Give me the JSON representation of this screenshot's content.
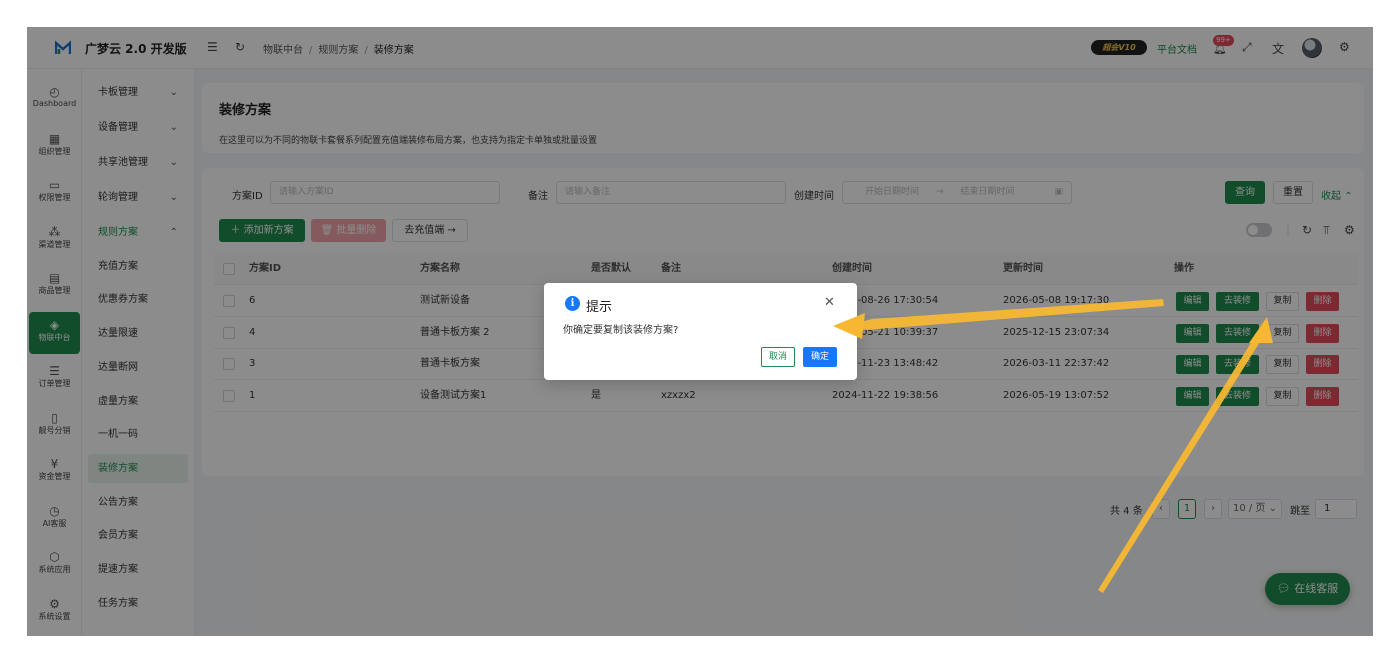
{
  "app": {
    "brand": "广梦云 2.0 开发版"
  },
  "breadcrumb": [
    "物联中台",
    "规则方案",
    "装修方案"
  ],
  "header_right": {
    "vip": "超会V10",
    "docs": "平台文档",
    "badge": "99+"
  },
  "rail": [
    {
      "label": "Dashboard",
      "icon": "dashboard-icon",
      "glyph": "◴"
    },
    {
      "label": "组织管理",
      "icon": "grid-icon",
      "glyph": "▦"
    },
    {
      "label": "权限管理",
      "icon": "monitor-icon",
      "glyph": "▭"
    },
    {
      "label": "渠道管理",
      "icon": "network-icon",
      "glyph": "⁂"
    },
    {
      "label": "商品管理",
      "icon": "store-icon",
      "glyph": "▤"
    },
    {
      "label": "物联中台",
      "icon": "iot-icon",
      "glyph": "◈"
    },
    {
      "label": "订单管理",
      "icon": "list-icon",
      "glyph": "☰"
    },
    {
      "label": "靓号分销",
      "icon": "phone-icon",
      "glyph": "▯"
    },
    {
      "label": "资金管理",
      "icon": "wallet-icon",
      "glyph": "¥"
    },
    {
      "label": "AI客服",
      "icon": "ai-icon",
      "glyph": "◷"
    },
    {
      "label": "系统应用",
      "icon": "cube-icon",
      "glyph": "⬡"
    },
    {
      "label": "系统设置",
      "icon": "gear-icon",
      "glyph": "⚙"
    }
  ],
  "submenu": [
    {
      "label": "卡板管理",
      "chev": "⌄"
    },
    {
      "label": "设备管理",
      "chev": "⌄"
    },
    {
      "label": "共享池管理",
      "chev": "⌄"
    },
    {
      "label": "轮询管理",
      "chev": "⌄"
    },
    {
      "label": "规则方案",
      "chev": "⌃"
    },
    {
      "label": "充值方案"
    },
    {
      "label": "优惠券方案"
    },
    {
      "label": "达量限速"
    },
    {
      "label": "达量断网"
    },
    {
      "label": "虚量方案"
    },
    {
      "label": "一机一码"
    },
    {
      "label": "装修方案"
    },
    {
      "label": "公告方案"
    },
    {
      "label": "会员方案"
    },
    {
      "label": "提速方案"
    },
    {
      "label": "任务方案"
    }
  ],
  "page": {
    "title": "装修方案",
    "description": "在这里可以为不同的物联卡套餐系列配置充值端装修布局方案，也支持为指定卡单独或批量设置"
  },
  "filters": {
    "id_label": "方案ID",
    "id_placeholder": "请输入方案ID",
    "remark_label": "备注",
    "remark_placeholder": "请输入备注",
    "time_label": "创建时间",
    "start_placeholder": "开始日期时间",
    "end_placeholder": "结束日期时间",
    "search": "查询",
    "reset": "重置",
    "collapse": "收起"
  },
  "actions": {
    "add": "添加新方案",
    "batch_delete": "批量删除",
    "goto": "去充值端"
  },
  "table": {
    "headers": [
      "方案ID",
      "方案名称",
      "是否默认",
      "备注",
      "创建时间",
      "更新时间",
      "操作"
    ],
    "rows": [
      {
        "id": "6",
        "name": "测试新设备",
        "default": "",
        "remark": "",
        "created": "2025-08-26 17:30:54",
        "updated": "2026-05-08 19:17:30"
      },
      {
        "id": "4",
        "name": "普通卡板方案 2",
        "default": "",
        "remark": "",
        "created": "2025-05-21 10:39:37",
        "updated": "2025-12-15 23:07:34"
      },
      {
        "id": "3",
        "name": "普通卡板方案",
        "default": "",
        "remark": "",
        "created": "2024-11-23 13:48:42",
        "updated": "2026-03-11 22:37:42"
      },
      {
        "id": "1",
        "name": "设备测试方案1",
        "default": "是",
        "remark": "xzxzx2",
        "created": "2024-11-22 19:38:56",
        "updated": "2026-05-19 13:07:52"
      }
    ],
    "row_actions": {
      "edit": "编辑",
      "decorate": "去装修",
      "copy": "复制",
      "delete": "删除"
    }
  },
  "pagination": {
    "total": "共 4 条",
    "current": "1",
    "page_size": "10 / 页",
    "jump_label": "跳至",
    "jump_value": "1"
  },
  "dialog": {
    "title": "提示",
    "message": "你确定要复制该装修方案?",
    "cancel": "取消",
    "ok": "确定"
  },
  "chat": {
    "label": "在线客服"
  },
  "colors": {
    "primary": "#1f8d4f",
    "danger": "#e34b5b",
    "info": "#1677ff",
    "arrow": "#f7b733"
  }
}
